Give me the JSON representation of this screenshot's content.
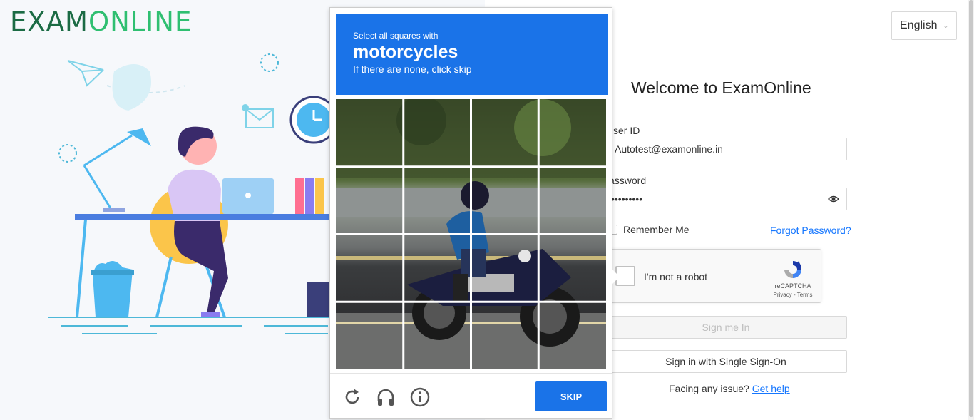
{
  "brand": {
    "logo_part1": "EXAM",
    "logo_part2": "ONLINE",
    "color_dark": "#1b6b44",
    "color_light": "#2fbf71"
  },
  "language": {
    "selected": "English"
  },
  "login": {
    "title": "Welcome to ExamOnline",
    "user_id_label": "ser ID",
    "user_id_value": "Autotest@examonline.in",
    "password_label": "assword",
    "password_value": "•••••••••",
    "remember_label": "Remember Me",
    "forgot_label": "Forgot Password?",
    "sign_in_label": "Sign me In",
    "sso_label": "Sign in with Single Sign-On",
    "help_text": "Facing any issue?",
    "help_link": "Get help"
  },
  "recaptcha": {
    "checkbox_label": "I'm not a robot",
    "brand": "reCAPTCHA",
    "terms": "Privacy - Terms"
  },
  "challenge": {
    "line1": "Select all squares with",
    "target": "motorcycles",
    "line3": "If there are none, click skip",
    "skip_label": "SKIP",
    "icons": [
      "reload-icon",
      "audio-icon",
      "info-icon"
    ],
    "accent": "#1a73e8"
  }
}
